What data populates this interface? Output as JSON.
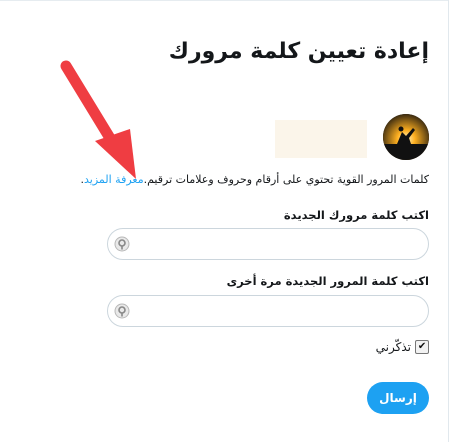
{
  "page": {
    "title": "إعادة تعيين كلمة مرورك"
  },
  "user": {
    "avatar_icon": "sunset-silhouette-avatar"
  },
  "info": {
    "text": "كلمات المرور القوية تحتوي على أرقام وحروف وعلامات ترقيم.",
    "link_label": "معرفة المزيد",
    "link_suffix": "."
  },
  "new_password": {
    "label": "اكتب كلمة مرورك الجديدة",
    "value": ""
  },
  "confirm_password": {
    "label": "اكتب كلمة المرور الجديدة مرة أخرى",
    "value": ""
  },
  "remember": {
    "label": "تذكّرني",
    "checked": true,
    "check_glyph": "✔"
  },
  "submit": {
    "label": "إرسال"
  },
  "colors": {
    "accent": "#1da1f2",
    "annotation_arrow": "#ef3d42"
  }
}
